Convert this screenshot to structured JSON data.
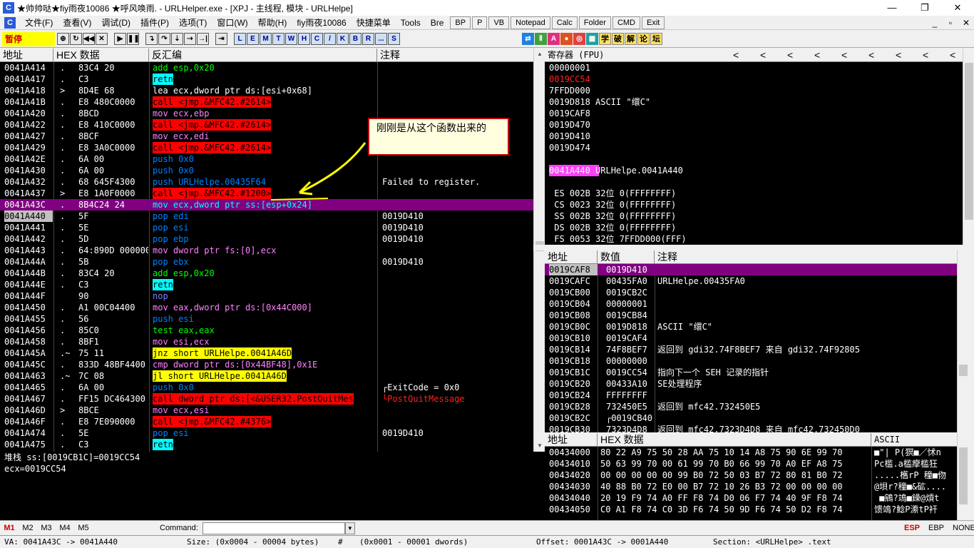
{
  "title": "★帅帅哒★fiy雨夜10086  ★呼风唤雨. - URLHelper.exe - [XPJ - 主线程, 模块 - URLHelpe]",
  "window_controls": [
    "—",
    "❐",
    "✕"
  ],
  "menu": [
    "文件(F)",
    "查看(V)",
    "调试(D)",
    "插件(P)",
    "选项(T)",
    "窗口(W)",
    "帮助(H)",
    "fiy雨夜10086",
    "快捷菜单",
    "Tools",
    "Bre"
  ],
  "menu_buttons": [
    "BP",
    "P",
    "VB",
    "Notepad",
    "Calc",
    "Folder",
    "CMD",
    "Exit"
  ],
  "mdi_controls": [
    "_",
    "▫",
    "✕"
  ],
  "toolbar": {
    "status": "暂停",
    "letter_buttons": [
      "L",
      "E",
      "M",
      "T",
      "W",
      "H",
      "C",
      "/",
      "K",
      "B",
      "R",
      "...",
      "S"
    ],
    "cn_buttons": [
      "学",
      "破",
      "解",
      "论",
      "坛"
    ]
  },
  "disasm": {
    "headers": [
      "地址",
      "HEX 数据",
      "反汇编",
      "注释"
    ],
    "rows": [
      {
        "addr": "0041A414",
        "m": ".",
        "hex": "83C4 20",
        "asm": "add esp,0x20",
        "cls": "t-green",
        "cmt": ""
      },
      {
        "addr": "0041A417",
        "m": ".",
        "hex": "C3",
        "asm": "retn",
        "cls": "t-ret",
        "cmt": ""
      },
      {
        "addr": "0041A418",
        "m": ">",
        "hex": "8D4E 68",
        "asm": "lea ecx,dword ptr ds:[esi+0x68]",
        "cls": "t-white",
        "cmt": ""
      },
      {
        "addr": "0041A41B",
        "m": ".",
        "hex": "E8 480C0000",
        "asm": "call <jmp.&MFC42.#2614>",
        "cls": "t-call",
        "cmt": ""
      },
      {
        "addr": "0041A420",
        "m": ".",
        "hex": "8BCD",
        "asm": "mov ecx,ebp",
        "cls": "t-mov",
        "cmt": ""
      },
      {
        "addr": "0041A422",
        "m": ".",
        "hex": "E8 410C0000",
        "asm": "call <jmp.&MFC42.#2614>",
        "cls": "t-call",
        "cmt": ""
      },
      {
        "addr": "0041A427",
        "m": ".",
        "hex": "8BCF",
        "asm": "mov ecx,edi",
        "cls": "t-mov",
        "cmt": ""
      },
      {
        "addr": "0041A429",
        "m": ".",
        "hex": "E8 3A0C0000",
        "asm": "call <jmp.&MFC42.#2614>",
        "cls": "t-call",
        "cmt": ""
      },
      {
        "addr": "0041A42E",
        "m": ".",
        "hex": "6A 00",
        "asm": "push 0x0",
        "cls": "t-push",
        "cmt": ""
      },
      {
        "addr": "0041A430",
        "m": ".",
        "hex": "6A 00",
        "asm": "push 0x0",
        "cls": "t-push",
        "cmt": ""
      },
      {
        "addr": "0041A432",
        "m": ".",
        "hex": "68 645F4300",
        "asm": "push URLHelpe.00435F64",
        "cls": "t-push",
        "cmt": "Failed to register."
      },
      {
        "addr": "0041A437",
        "m": ">",
        "hex": "E8 1A0F0000",
        "asm": "call <jmp.&MFC42.#1200>",
        "cls": "t-call",
        "cmt": ""
      },
      {
        "addr": "0041A43C",
        "m": ".",
        "hex": "8B4C24 24",
        "asm": "mov ecx,dword ptr ss:[esp+0x24]",
        "cls": "t-mov",
        "cmt": "",
        "sel": true
      },
      {
        "addr": "0041A440",
        "m": ".",
        "hex": "5F",
        "asm": "pop edi",
        "cls": "t-push",
        "cmt": "0019D410",
        "cur": true
      },
      {
        "addr": "0041A441",
        "m": ".",
        "hex": "5E",
        "asm": "pop esi",
        "cls": "t-push",
        "cmt": "0019D410"
      },
      {
        "addr": "0041A442",
        "m": ".",
        "hex": "5D",
        "asm": "pop ebp",
        "cls": "t-push",
        "cmt": "0019D410"
      },
      {
        "addr": "0041A443",
        "m": ".",
        "hex": "64:890D 0000000",
        "asm": "mov dword ptr fs:[0],ecx",
        "cls": "t-mov",
        "cmt": ""
      },
      {
        "addr": "0041A44A",
        "m": ".",
        "hex": "5B",
        "asm": "pop ebx",
        "cls": "t-push",
        "cmt": "0019D410"
      },
      {
        "addr": "0041A44B",
        "m": ".",
        "hex": "83C4 20",
        "asm": "add esp,0x20",
        "cls": "t-green",
        "cmt": ""
      },
      {
        "addr": "0041A44E",
        "m": ".",
        "hex": "C3",
        "asm": "retn",
        "cls": "t-ret",
        "cmt": ""
      },
      {
        "addr": "0041A44F",
        "m": "",
        "hex": "90",
        "asm": "nop",
        "cls": "t-gray",
        "cmt": ""
      },
      {
        "addr": "0041A450",
        "m": ".",
        "hex": "A1 00C04400",
        "asm": "mov eax,dword ptr ds:[0x44C000]",
        "cls": "t-mov",
        "cmt": ""
      },
      {
        "addr": "0041A455",
        "m": ".",
        "hex": "56",
        "asm": "push esi",
        "cls": "t-push",
        "cmt": ""
      },
      {
        "addr": "0041A456",
        "m": ".",
        "hex": "85C0",
        "asm": "test eax,eax",
        "cls": "t-green",
        "cmt": ""
      },
      {
        "addr": "0041A458",
        "m": ".",
        "hex": "8BF1",
        "asm": "mov esi,ecx",
        "cls": "t-mov",
        "cmt": ""
      },
      {
        "addr": "0041A45A",
        "m": ".~",
        "hex": "75 11",
        "asm": "jnz short URLHelpe.0041A46D",
        "cls": "t-jmp",
        "cmt": ""
      },
      {
        "addr": "0041A45C",
        "m": ".",
        "hex": "833D 48BF4400",
        "asm": "cmp dword ptr ds:[0x44BF48],0x1E",
        "cls": "t-mov",
        "cmt": ""
      },
      {
        "addr": "0041A463",
        "m": ".~",
        "hex": "7C 08",
        "asm": "jl short URLHelpe.0041A46D",
        "cls": "t-jmp",
        "cmt": ""
      },
      {
        "addr": "0041A465",
        "m": ".",
        "hex": "6A 00",
        "asm": "push 0x0",
        "cls": "t-push",
        "cmt": "┌ExitCode = 0x0"
      },
      {
        "addr": "0041A467",
        "m": ".",
        "hex": "FF15 DC464300",
        "asm": "call dword ptr ds:[<&USER32.PostQuitMes",
        "cls": "t-call",
        "cmt": "└PostQuitMessage",
        "cmtred": true
      },
      {
        "addr": "0041A46D",
        "m": ">",
        "hex": "8BCE",
        "asm": "mov ecx,esi",
        "cls": "t-mov",
        "cmt": ""
      },
      {
        "addr": "0041A46F",
        "m": ".",
        "hex": "E8 7E090000",
        "asm": "call <jmp.&MFC42.#4376>",
        "cls": "t-call",
        "cmt": ""
      },
      {
        "addr": "0041A474",
        "m": ".",
        "hex": "5E",
        "asm": "pop esi",
        "cls": "t-push",
        "cmt": "0019D410"
      },
      {
        "addr": "0041A475",
        "m": ".",
        "hex": "C3",
        "asm": "retn",
        "cls": "t-ret",
        "cmt": ""
      }
    ]
  },
  "info_lines": [
    "堆栈 ss:[0019CB1C]=0019CC54",
    "ecx=0019CC54"
  ],
  "callout_text": "刚刚是从这个函数出来的",
  "registers": {
    "header": "寄存器 (FPU)",
    "arrows": [
      "<",
      "<",
      "<",
      "<",
      "<",
      "<",
      "<",
      "<",
      "<"
    ],
    "rows": [
      {
        "t": "00000001",
        "c": "#fff"
      },
      {
        "t": "0019CC54",
        "c": "#ff2020"
      },
      {
        "t": "7FFDD000",
        "c": "#fff"
      },
      {
        "t": "0019D818 ASCII \"缳C\"",
        "c": "#fff"
      },
      {
        "t": "0019CAF8",
        "c": "#fff"
      },
      {
        "t": "0019D470",
        "c": "#fff"
      },
      {
        "t": "0019D410",
        "c": "#fff"
      },
      {
        "t": "0019D474",
        "c": "#fff"
      },
      {
        "t": "",
        "c": "#fff"
      },
      {
        "t": "0041A440 URLHelpe.0041A440",
        "c": "#fff",
        "eip": true
      },
      {
        "t": "",
        "c": "#fff"
      },
      {
        "t": " ES 002B 32位 0(FFFFFFFF)",
        "c": "#fff"
      },
      {
        "t": " CS 0023 32位 0(FFFFFFFF)",
        "c": "#fff"
      },
      {
        "t": " SS 002B 32位 0(FFFFFFFF)",
        "c": "#fff"
      },
      {
        "t": " DS 002B 32位 0(FFFFFFFF)",
        "c": "#fff"
      },
      {
        "t": " FS 0053 32位 7FFDD000(FFF)",
        "c": "#fff"
      },
      {
        "t": " GS 002B 32位 0(FFFFFFFF)",
        "c": "#fff"
      }
    ]
  },
  "stack": {
    "headers": [
      "地址",
      "数值",
      "注释"
    ],
    "rows": [
      {
        "a": "0019CAF8",
        "v": "0019D410",
        "c": "",
        "sel": true
      },
      {
        "a": "0019CAFC",
        "v": "00435FA0",
        "c": "URLHelpe.00435FA0"
      },
      {
        "a": "0019CB00",
        "v": "0019CB2C",
        "c": ""
      },
      {
        "a": "0019CB04",
        "v": "00000001",
        "c": ""
      },
      {
        "a": "0019CB08",
        "v": "0019CB84",
        "c": ""
      },
      {
        "a": "0019CB0C",
        "v": "0019D818",
        "c": "ASCII \"缳C\""
      },
      {
        "a": "0019CB10",
        "v": "0019CAF4",
        "c": ""
      },
      {
        "a": "0019CB14",
        "v": "74F8BEF7",
        "c": "返回到 gdi32.74F8BEF7 来自 gdi32.74F92805"
      },
      {
        "a": "0019CB18",
        "v": "00000000",
        "c": ""
      },
      {
        "a": "0019CB1C",
        "v": "0019CC54",
        "c": "指向下一个 SEH 记录的指针"
      },
      {
        "a": "0019CB20",
        "v": "00433A10",
        "c": "SE处理程序"
      },
      {
        "a": "0019CB24",
        "v": "FFFFFFFF",
        "c": ""
      },
      {
        "a": "0019CB28",
        "v": "732450E5",
        "c": "返回到 mfc42.732450E5"
      },
      {
        "a": "0019CB2C",
        "v": "┌0019CB40",
        "c": ""
      },
      {
        "a": "0019CB30",
        "v": "7323D4D8",
        "c": "返回到 mfc42.7323D4D8 来自 mfc42.732450D0"
      }
    ]
  },
  "dump": {
    "headers": [
      "地址",
      "HEX 数据",
      "ASCII"
    ],
    "rows": [
      {
        "a": "00434000",
        "h": "80 22 A9 75 50 28 AA 75 10 14 A8 75 90 6E 99 70",
        "s": "■\"| P(猽■／怵n"
      },
      {
        "a": "00434010",
        "h": "50 63 99 70 00 61 99 70 B0 66 99 70 A0 EF A8 75",
        "s": "Pc槛.a槛癴槛狂"
      },
      {
        "a": "00434020",
        "h": "00 00 00 00 00 99 B0 72 50 03 B7 72 80 81 B0 72",
        "s": ".....欍rP 穜■伆"
      },
      {
        "a": "00434030",
        "h": "40 88 B0 72 E0 00 B7 72 10 26 B3 72 00 00 00 00",
        "s": "@垻r?穜■&砿...."
      },
      {
        "a": "00434040",
        "h": "20 19 F9 74 A0 FF F8 74 D0 06 F7 74 40 9F F8 74",
        "s": " ■鵷?鴗■鐰@熕t"
      },
      {
        "a": "00434050",
        "h": "C0 A1 F8 74 C0 3D F6 74 50 9D F6 74 50 D2 F8 74",
        "s": "馈鴗?鯰P潫tP衦"
      }
    ]
  },
  "cmdbar": {
    "m_buttons": [
      "M1",
      "M2",
      "M3",
      "M4",
      "M5"
    ],
    "command_label": "Command:",
    "regs": [
      "ESP",
      "EBP",
      "NONE"
    ]
  },
  "statusbar": {
    "va": "VA: 0041A43C -> 0041A440",
    "size": "Size: (0x0004 - 00004 bytes)",
    "hash": "#",
    "dwords": "(0x0001 - 00001 dwords)",
    "offset": "Offset: 0001A43C -> 0001A440",
    "section": "Section: <URLHelpe> .text"
  }
}
